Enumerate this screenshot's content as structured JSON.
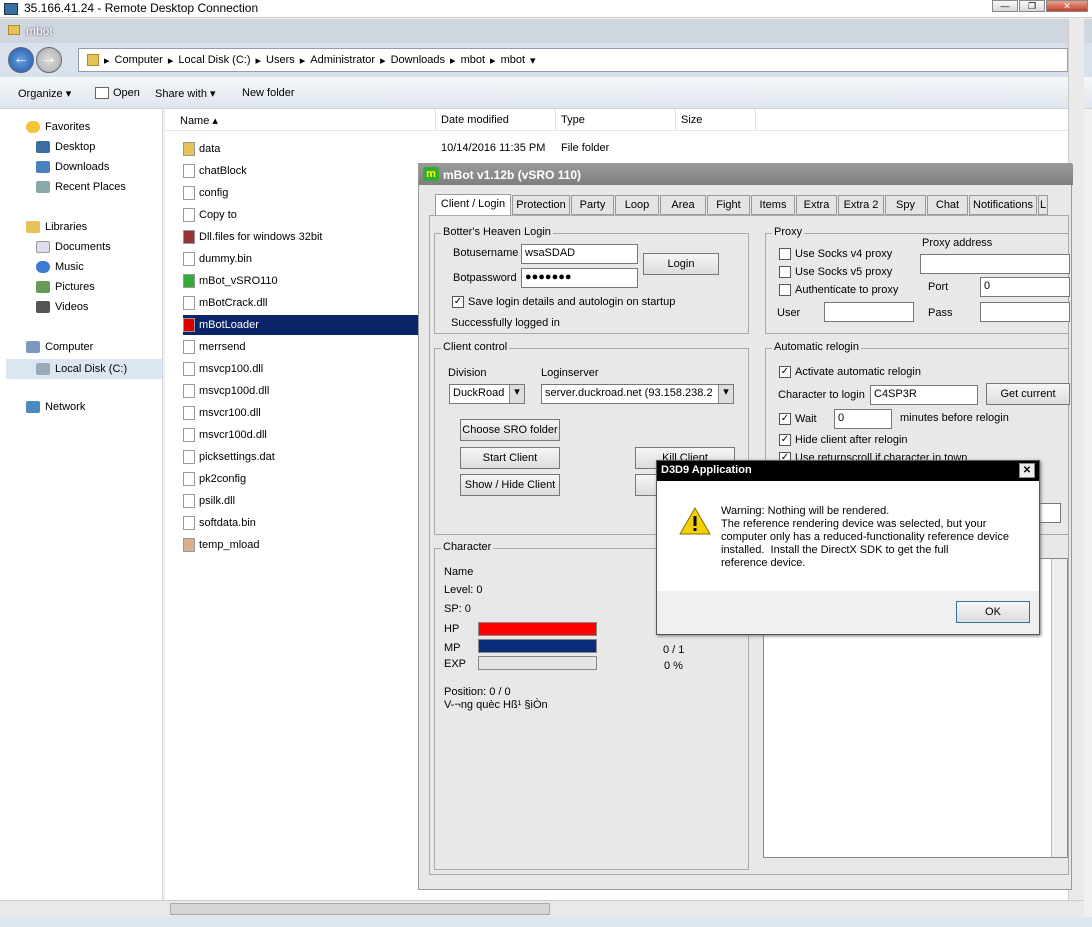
{
  "rdp": {
    "title": "35.166.41.24 - Remote Desktop Connection"
  },
  "explorer": {
    "title": "mbot",
    "breadcrumb": [
      "Computer",
      "Local Disk (C:)",
      "Users",
      "Administrator",
      "Downloads",
      "mbot",
      "mbot"
    ],
    "toolbar": {
      "organize": "Organize",
      "open": "Open",
      "share": "Share with",
      "new_folder": "New folder"
    },
    "nav": {
      "favorites": "Favorites",
      "desktop": "Desktop",
      "downloads": "Downloads",
      "recent": "Recent Places",
      "libraries": "Libraries",
      "documents": "Documents",
      "music": "Music",
      "pictures": "Pictures",
      "videos": "Videos",
      "computer": "Computer",
      "local_disk": "Local Disk (C:)",
      "network": "Network"
    },
    "columns": {
      "name": "Name",
      "date": "Date modified",
      "type": "Type",
      "size": "Size"
    },
    "first_row": {
      "date": "10/14/2016 11:35 PM",
      "type": "File folder"
    },
    "files": [
      "data",
      "chatBlock",
      "config",
      "Copy to",
      "Dll.files for windows 32bit",
      "dummy.bin",
      "mBot_vSRO110",
      "mBotCrack.dll",
      "mBotLoader",
      "merrsend",
      "msvcp100.dll",
      "msvcp100d.dll",
      "msvcr100.dll",
      "msvcr100d.dll",
      "picksettings.dat",
      "pk2config",
      "psilk.dll",
      "softdata.bin",
      "temp_mload"
    ]
  },
  "mbot": {
    "title": "mBot v1.12b (vSRO 110)",
    "logo": "m",
    "tabs": [
      "Client / Login",
      "Protection",
      "Party",
      "Loop",
      "Area",
      "Fight",
      "Items",
      "Extra",
      "Extra 2",
      "Spy",
      "Chat",
      "Notifications",
      "L"
    ],
    "login": {
      "group": "Botter's Heaven Login",
      "user_label": "Botusername",
      "user_value": "wsaSDAD",
      "pass_label": "Botpassword",
      "pass_value": "●●●●●●●",
      "login_btn": "Login",
      "save_label": "Save login details and autologin on startup",
      "status": "Successfully logged in"
    },
    "proxy": {
      "group": "Proxy",
      "socks4": "Use Socks v4 proxy",
      "socks5": "Use Socks v5 proxy",
      "auth": "Authenticate to proxy",
      "address_label": "Proxy address",
      "port_label": "Port",
      "port_value": "0",
      "user_label": "User",
      "pass_label": "Pass"
    },
    "client": {
      "group": "Client control",
      "division_label": "Division",
      "division_value": "DuckRoad",
      "loginserver_label": "Loginserver",
      "loginserver_value": "server.duckroad.net (93.158.238.2",
      "choose_btn": "Choose SRO folder",
      "start_btn": "Start Client",
      "show_btn": "Show / Hide Client",
      "kill_btn": "Kill Client"
    },
    "relogin": {
      "group": "Automatic relogin",
      "activate": "Activate automatic relogin",
      "char_label": "Character to login",
      "char_value": "C4SP3R",
      "get_current": "Get current",
      "wait_label": "Wait",
      "wait_value": "0",
      "wait_suffix": "minutes before relogin",
      "hide": "Hide client after relogin",
      "returnscroll": "Use returnscroll if character in town"
    },
    "character": {
      "group": "Character",
      "name": "Name",
      "level": "Level: 0",
      "sp": "SP: 0",
      "hp": "HP",
      "mp": "MP",
      "exp": "EXP",
      "mp_value": "0 / 1",
      "exp_value": "0 %",
      "position": "Position: 0 / 0",
      "region": "V-¬ng quèc Hß¹ §iÒn",
      "hp_fill": 1.0,
      "mp_fill": 1.0,
      "exp_fill": 0.0
    },
    "colors": {
      "hp": "#ff0000",
      "mp": "#0a2a7a"
    }
  },
  "dialog": {
    "title": "D3D9 Application",
    "message": "Warning: Nothing will be rendered.\nThe reference rendering device was selected, but your\ncomputer only has a reduced-functionality reference device\ninstalled.  Install the DirectX SDK to get the full\nreference device.",
    "ok": "OK"
  }
}
